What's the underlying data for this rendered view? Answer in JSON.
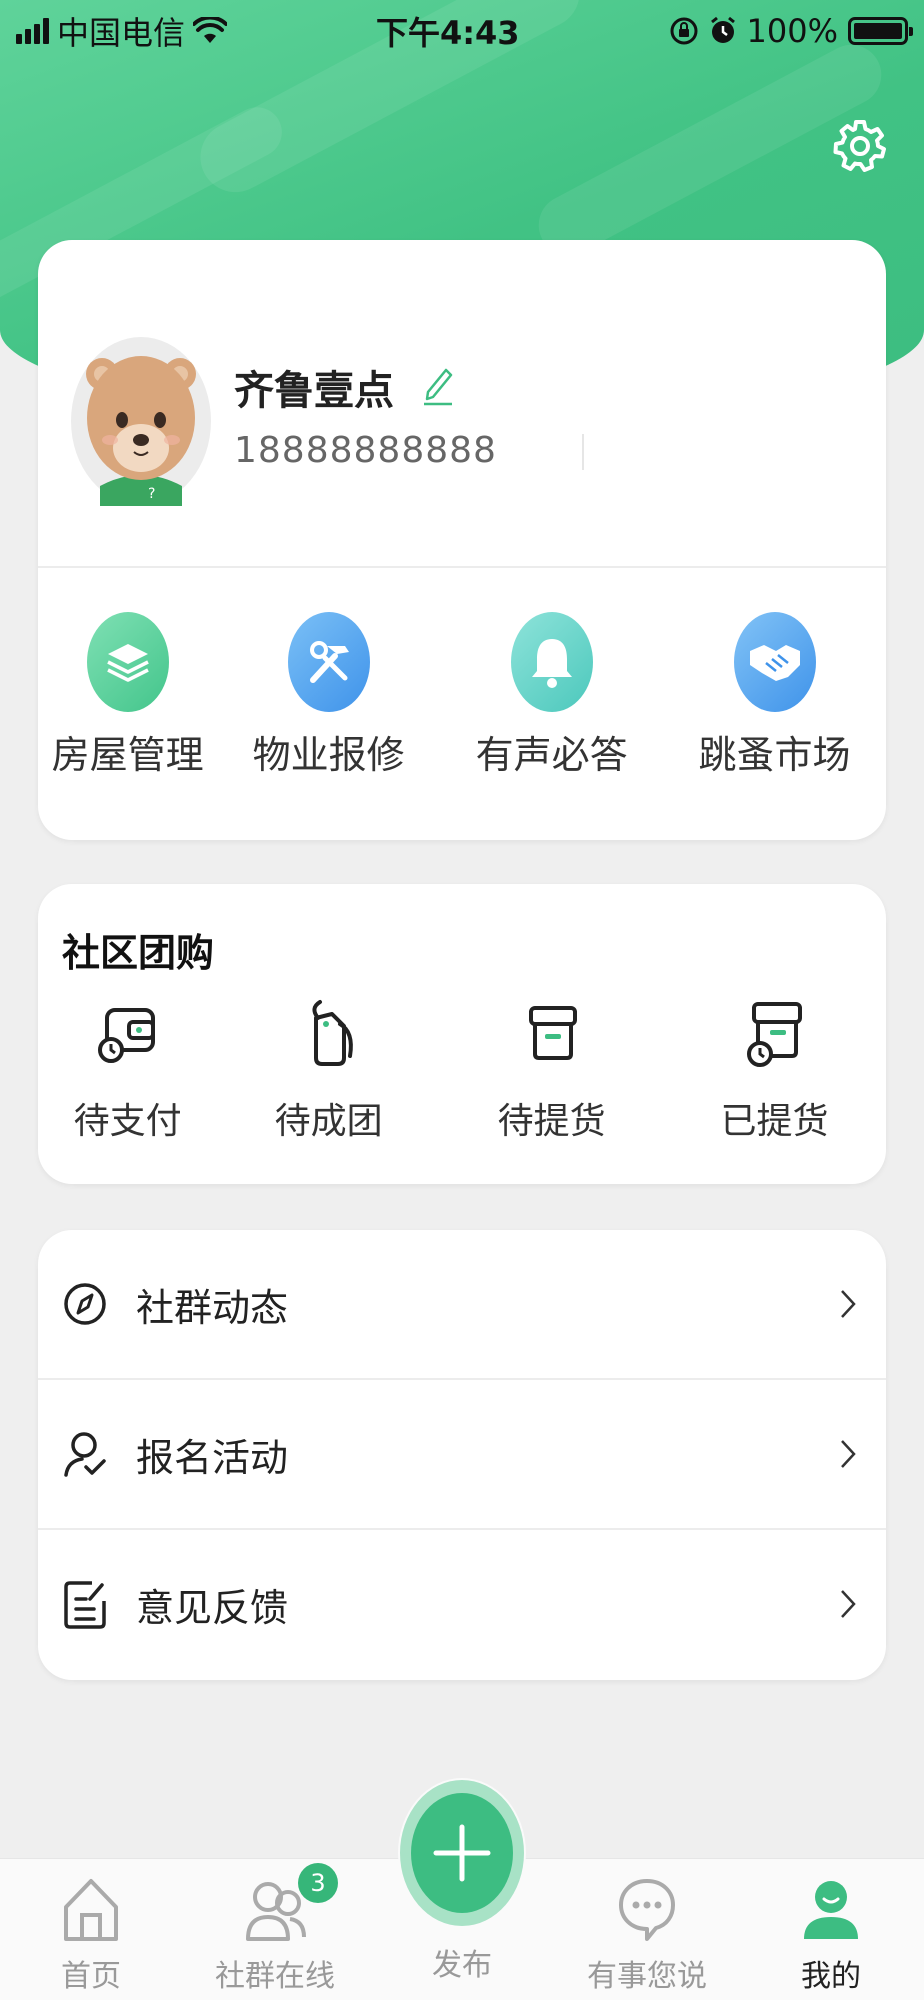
{
  "status_bar": {
    "carrier": "中国电信",
    "time": "下午4:43",
    "battery": "100%",
    "icons": [
      "signal-icon",
      "wifi-icon",
      "rotation-lock-icon",
      "alarm-icon",
      "battery-icon"
    ]
  },
  "header": {
    "settings_icon": "gear-icon"
  },
  "profile": {
    "name": "齐鲁壹点",
    "phone": "18888888888",
    "avatar_icon": "bear-avatar",
    "edit_icon": "pencil-icon"
  },
  "quick_actions": [
    {
      "label": "房屋管理",
      "icon": "layers-icon",
      "color": "#4ccf9a"
    },
    {
      "label": "物业报修",
      "icon": "tools-icon",
      "color": "#4aa0ef"
    },
    {
      "label": "有声必答",
      "icon": "bell-icon",
      "color": "#5fd1c6"
    },
    {
      "label": "跳蚤市场",
      "icon": "handshake-icon",
      "color": "#4aa0ef"
    }
  ],
  "group_buy": {
    "title": "社区团购",
    "items": [
      {
        "label": "待支付",
        "icon": "wallet-clock-icon"
      },
      {
        "label": "待成团",
        "icon": "tag-icon"
      },
      {
        "label": "待提货",
        "icon": "box-icon"
      },
      {
        "label": "已提货",
        "icon": "box-clock-icon"
      }
    ]
  },
  "menu": [
    {
      "label": "社群动态",
      "icon": "compass-icon"
    },
    {
      "label": "报名活动",
      "icon": "user-check-icon"
    },
    {
      "label": "意见反馈",
      "icon": "feedback-icon"
    }
  ],
  "tabbar": {
    "tabs": [
      {
        "label": "首页",
        "icon": "home-icon"
      },
      {
        "label": "社群在线",
        "icon": "users-icon",
        "badge": "3"
      },
      {
        "label": "发布",
        "icon": "plus-icon"
      },
      {
        "label": "有事您说",
        "icon": "chat-icon"
      },
      {
        "label": "我的",
        "icon": "person-icon"
      }
    ],
    "active": "我的"
  },
  "colors": {
    "brand_green": "#3dbd82",
    "header_green": "#4fca8d",
    "background": "#efefef"
  }
}
